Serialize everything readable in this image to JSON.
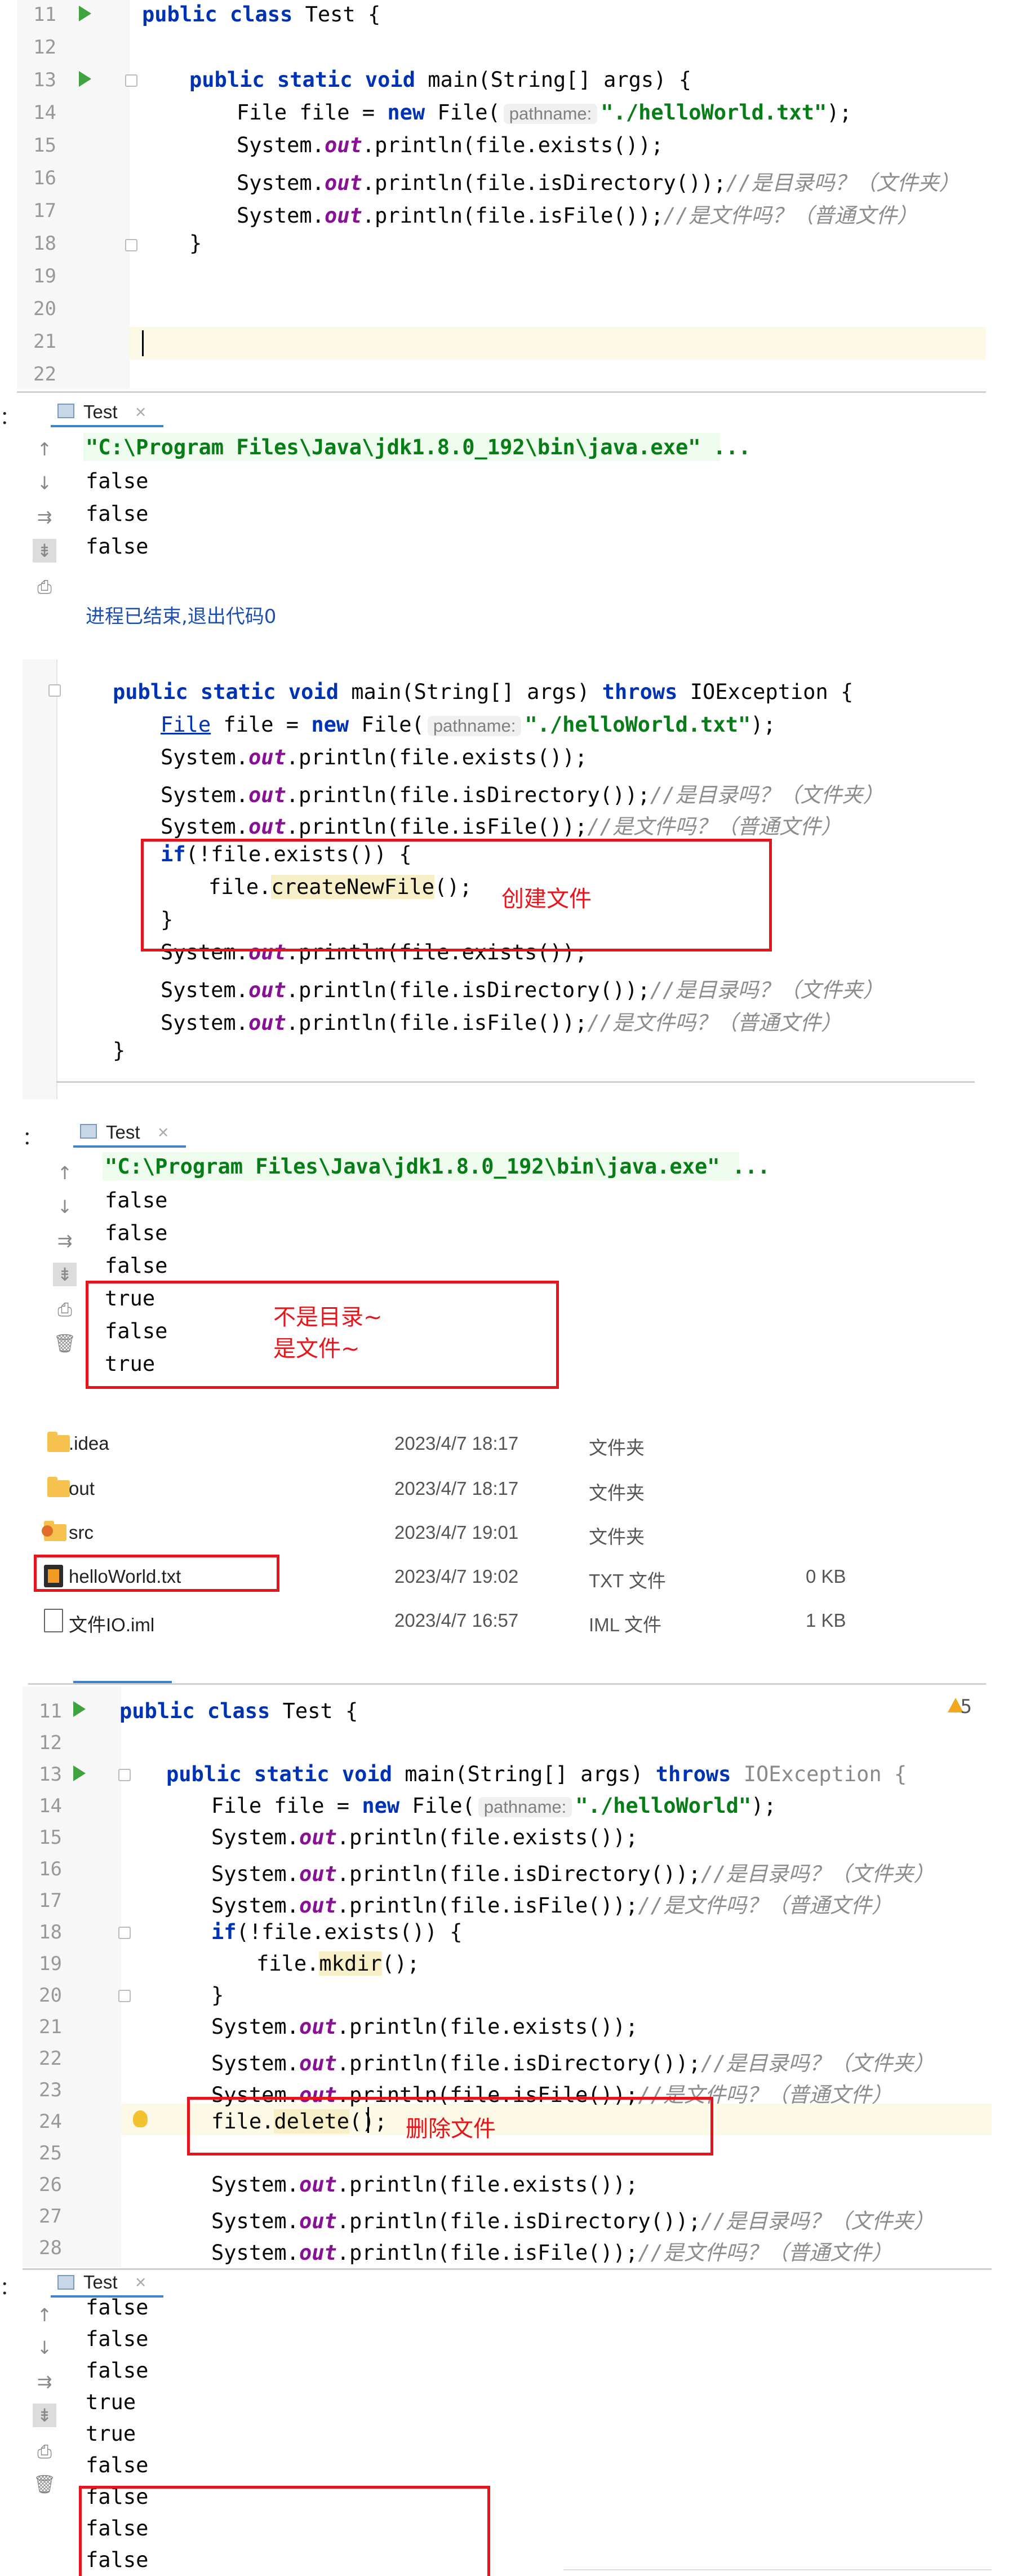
{
  "section1": {
    "line_numbers": [
      "11",
      "12",
      "13",
      "14",
      "15",
      "16",
      "17",
      "18",
      "19",
      "20",
      "21",
      "22"
    ],
    "lines": {
      "l11": {
        "kw": "public class",
        "rest": " Test {"
      },
      "l13": {
        "kw": "public static void",
        "rest": " main(String[] args) {"
      },
      "l14": {
        "a": "File file = ",
        "kw": "new",
        "b": " File(",
        "hint": "pathname:",
        "str": "\"./helloWorld.txt\"",
        "c": ");"
      },
      "l15": {
        "a": "System.",
        "fld": "out",
        "b": ".println(file.exists());"
      },
      "l16": {
        "a": "System.",
        "fld": "out",
        "b": ".println(file.isDirectory());",
        "cmt": "//是目录吗？（文件夹）"
      },
      "l17": {
        "a": "System.",
        "fld": "out",
        "b": ".println(file.isFile());",
        "cmt": "//是文件吗？（普通文件）"
      },
      "l18": {
        "rest": "}"
      }
    }
  },
  "console1": {
    "tab": "Test",
    "left_label": "：",
    "cmd": "\"C:\\Program Files\\Java\\jdk1.8.0_192\\bin\\java.exe\" ...",
    "outputs": [
      "false",
      "false",
      "false"
    ],
    "exit": "进程已结束,退出代码0"
  },
  "section2": {
    "l1": {
      "kw": "public static void",
      "a": " main(String[] args) ",
      "kw2": "throws",
      "b": " IOException {"
    },
    "l2": {
      "link": "File",
      "a": " file = ",
      "kw": "new",
      "b": " File(",
      "hint": "pathname:",
      "str": "\"./helloWorld.txt\"",
      "c": ");"
    },
    "l3": {
      "a": "System.",
      "fld": "out",
      "b": ".println(file.exists());"
    },
    "l4": {
      "a": "System.",
      "fld": "out",
      "b": ".println(file.isDirectory());",
      "cmt": "//是目录吗？（文件夹）"
    },
    "l5": {
      "a": "System.",
      "fld": "out",
      "b": ".println(file.isFile());",
      "cmt": "//是文件吗？（普通文件）"
    },
    "l6": {
      "kw": "if",
      "a": "(!file.exists()) {"
    },
    "l7": {
      "a": "file.",
      "m": "createNewFile",
      "b": "();"
    },
    "l8": {
      "a": "}"
    },
    "l9": {
      "a": "System.",
      "fld": "out",
      "b": ".println(file.exists());"
    },
    "l10": {
      "a": "System.",
      "fld": "out",
      "b": ".println(file.isDirectory());",
      "cmt": "//是目录吗？（文件夹）"
    },
    "l11": {
      "a": "System.",
      "fld": "out",
      "b": ".println(file.isFile());",
      "cmt": "//是文件吗？（普通文件）"
    },
    "l12": {
      "a": "}"
    },
    "annotation": "创建文件"
  },
  "console2": {
    "tab": "Test",
    "left_label": "：",
    "cmd": "\"C:\\Program Files\\Java\\jdk1.8.0_192\\bin\\java.exe\" ...",
    "outputs": [
      "false",
      "false",
      "false",
      "true",
      "false",
      "true"
    ],
    "annotation_line1": "不是目录~",
    "annotation_line2": "是文件~"
  },
  "explorer": {
    "rows": [
      {
        "name": ".idea",
        "date": "2023/4/7 18:17",
        "type": "文件夹",
        "size": ""
      },
      {
        "name": "out",
        "date": "2023/4/7 18:17",
        "type": "文件夹",
        "size": ""
      },
      {
        "name": "src",
        "date": "2023/4/7 19:01",
        "type": "文件夹",
        "size": ""
      },
      {
        "name": "helloWorld.txt",
        "date": "2023/4/7 19:02",
        "type": "TXT 文件",
        "size": "0 KB"
      },
      {
        "name": "文件IO.iml",
        "date": "2023/4/7 16:57",
        "type": "IML 文件",
        "size": "1 KB"
      }
    ]
  },
  "section3": {
    "warning_count": "5",
    "line_numbers": [
      "11",
      "12",
      "13",
      "14",
      "15",
      "16",
      "17",
      "18",
      "19",
      "20",
      "21",
      "22",
      "23",
      "24",
      "25",
      "26",
      "27",
      "28"
    ],
    "l11": {
      "kw": "public class",
      "rest": " Test {"
    },
    "l13": {
      "kw": "public static void",
      "a": " main(String[] args) ",
      "kw2": "throws",
      "b": " IOException {"
    },
    "l14": {
      "a": "File file = ",
      "kw": "new",
      "b": " File(",
      "hint": "pathname:",
      "str": "\"./helloWorld\"",
      "c": ");"
    },
    "l15": {
      "a": "System.",
      "fld": "out",
      "b": ".println(file.exists());"
    },
    "l16": {
      "a": "System.",
      "fld": "out",
      "b": ".println(file.isDirectory());",
      "cmt": "//是目录吗？（文件夹）"
    },
    "l17": {
      "a": "System.",
      "fld": "out",
      "b": ".println(file.isFile());",
      "cmt": "//是文件吗？（普通文件）"
    },
    "l18": {
      "kw": "if",
      "a": "(!file.exists()) {"
    },
    "l19": {
      "a": "file.",
      "m": "mkdir",
      "b": "();"
    },
    "l20": {
      "a": "}"
    },
    "l21": {
      "a": "System.",
      "fld": "out",
      "b": ".println(file.exists());"
    },
    "l22": {
      "a": "System.",
      "fld": "out",
      "b": ".println(file.isDirectory());",
      "cmt": "//是目录吗？（文件夹）"
    },
    "l23": {
      "a": "System.",
      "fld": "out",
      "b": ".println(file.isFile());",
      "cmt": "//是文件吗？（普通文件）"
    },
    "l24": {
      "a": "file.",
      "m": "delete",
      "b": "();"
    },
    "l26": {
      "a": "System.",
      "fld": "out",
      "b": ".println(file.exists());"
    },
    "l27": {
      "a": "System.",
      "fld": "out",
      "b": ".println(file.isDirectory());",
      "cmt": "//是目录吗？（文件夹）"
    },
    "l28": {
      "a": "System.",
      "fld": "out",
      "b": ".println(file.isFile());",
      "cmt": "//是文件吗？（普通文件）"
    },
    "annotation": "删除文件"
  },
  "console3": {
    "tab": "Test",
    "left_label": "：",
    "outputs": [
      "false",
      "false",
      "false",
      "true",
      "true",
      "false",
      "false",
      "false",
      "false"
    ]
  },
  "colors": {
    "accent_red": "#e8141c",
    "keyword": "#0033b3",
    "string": "#067d17",
    "field": "#871094",
    "run_green": "#3fa33f"
  }
}
